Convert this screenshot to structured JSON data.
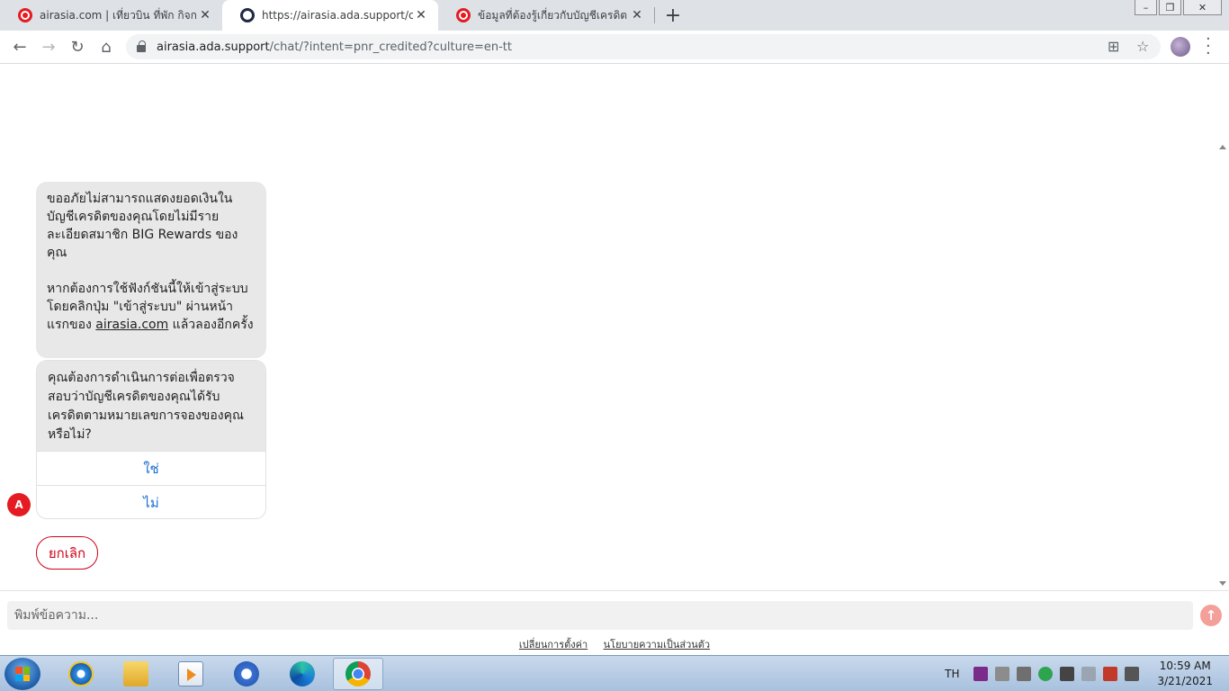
{
  "browser": {
    "tabs": [
      {
        "title": "airasia.com | เที่ยวบิน ที่พัก กิจกรรม",
        "active": false,
        "favicon": "airasia-icon"
      },
      {
        "title": "https://airasia.ada.support/chat/?",
        "active": true,
        "favicon": "ada-icon"
      },
      {
        "title": "ข้อมูลที่ต้องรู้เกี่ยวกับบัญชีเครดิต",
        "active": false,
        "favicon": "airasia-icon"
      }
    ],
    "url_host": "airasia.ada.support",
    "url_path": "/chat/?intent=pnr_credited?culture=en-tt"
  },
  "chat": {
    "bubble1": "ขออภัยไม่สามารถแสดงยอดเงินในบัญชีเครดิตของคุณโดยไม่มีรายละเอียดสมาชิก BIG Rewards ของคุณ\n\nหากต้องการใช้ฟังก์ชันนี้ให้เข้าสู่ระบบโดยคลิกปุ่ม \"เข้าสู่ระบบ\" ผ่านหน้าแรกของ ",
    "bubble1_link": "airasia.com",
    "bubble1_tail": " แล้วลองอีกครั้ง",
    "question": "คุณต้องการดำเนินการต่อเพื่อตรวจสอบว่าบัญชีเครดิตของคุณได้รับเครดิตตามหมายเลขการจองของคุณหรือไม่?",
    "option_yes": "ใช่",
    "option_no": "ไม่",
    "bot_avatar_letter": "A",
    "cancel_label": "ยกเลิก",
    "input_placeholder": "พิมพ์ข้อความ...",
    "footer_link_settings": "เปลี่ยนการตั้งค่า",
    "footer_link_privacy": "นโยบายความเป็นส่วนตัว"
  },
  "taskbar": {
    "lang": "TH",
    "time": "10:59 AM",
    "date": "3/21/2021"
  },
  "colors": {
    "brand_red": "#e51b23",
    "link_blue": "#1a6fd1",
    "bubble_bg": "#e8e8e8"
  }
}
